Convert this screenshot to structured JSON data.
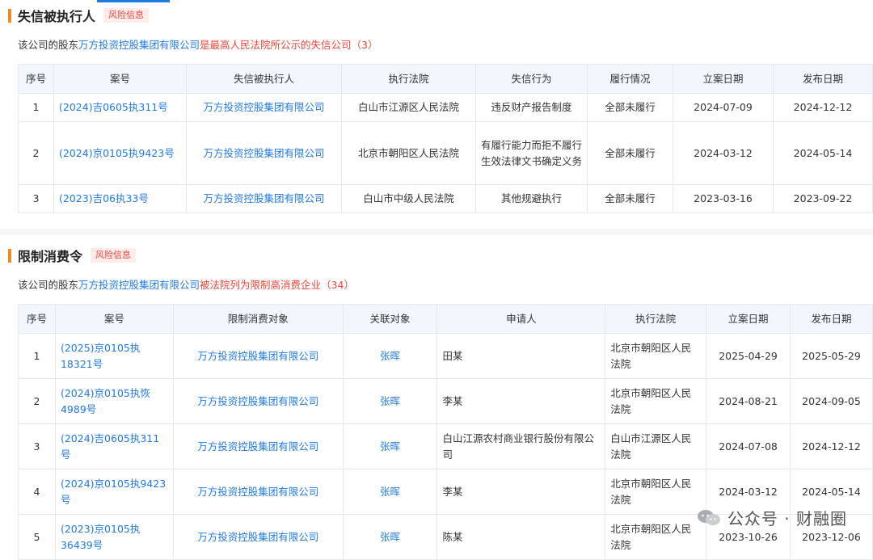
{
  "section1": {
    "title": "失信被执行人",
    "risk_tag": "风险信息",
    "summary_prefix": "该公司的股东",
    "summary_company": "万方投资控股集团有限公司",
    "summary_mid": "是最高人民法院所公示的失信公司",
    "summary_count": "（3）",
    "columns": [
      "序号",
      "案号",
      "失信被执行人",
      "执行法院",
      "失信行为",
      "履行情况",
      "立案日期",
      "发布日期"
    ],
    "rows": [
      {
        "no": "1",
        "case": "(2024)吉0605执311号",
        "party": "万方投资控股集团有限公司",
        "court": "白山市江源区人民法院",
        "behavior": "违反财产报告制度",
        "status": "全部未履行",
        "filed": "2024-07-09",
        "published": "2024-12-12"
      },
      {
        "no": "2",
        "case": "(2024)京0105执9423号",
        "party": "万方投资控股集团有限公司",
        "court": "北京市朝阳区人民法院",
        "behavior": "有履行能力而拒不履行生效法律文书确定义务",
        "status": "全部未履行",
        "filed": "2024-03-12",
        "published": "2024-05-14"
      },
      {
        "no": "3",
        "case": "(2023)吉06执33号",
        "party": "万方投资控股集团有限公司",
        "court": "白山市中级人民法院",
        "behavior": "其他规避执行",
        "status": "全部未履行",
        "filed": "2023-03-16",
        "published": "2023-09-22"
      }
    ]
  },
  "section2": {
    "title": "限制消费令",
    "risk_tag": "风险信息",
    "summary_prefix": "该公司的股东",
    "summary_company": "万方投资控股集团有限公司",
    "summary_mid": "被法院列为限制高消费企业",
    "summary_count": "（34）",
    "columns": [
      "序号",
      "案号",
      "限制消费对象",
      "关联对象",
      "申请人",
      "执行法院",
      "立案日期",
      "发布日期"
    ],
    "rows": [
      {
        "no": "1",
        "case": "(2025)京0105执18321号",
        "target": "万方投资控股集团有限公司",
        "related": "张晖",
        "applicant": "田某",
        "court": "北京市朝阳区人民法院",
        "filed": "2025-04-29",
        "published": "2025-05-29"
      },
      {
        "no": "2",
        "case": "(2024)京0105执恢4989号",
        "target": "万方投资控股集团有限公司",
        "related": "张晖",
        "applicant": "李某",
        "court": "北京市朝阳区人民法院",
        "filed": "2024-08-21",
        "published": "2024-09-05"
      },
      {
        "no": "3",
        "case": "(2024)吉0605执311号",
        "target": "万方投资控股集团有限公司",
        "related": "张晖",
        "applicant": "白山江源农村商业银行股份有限公司",
        "court": "白山市江源区人民法院",
        "filed": "2024-07-08",
        "published": "2024-12-12"
      },
      {
        "no": "4",
        "case": "(2024)京0105执9423号",
        "target": "万方投资控股集团有限公司",
        "related": "张晖",
        "applicant": "李某",
        "court": "北京市朝阳区人民法院",
        "filed": "2024-03-12",
        "published": "2024-05-14"
      },
      {
        "no": "5",
        "case": "(2023)京0105执36439号",
        "target": "万方投资控股集团有限公司",
        "related": "张晖",
        "applicant": "陈某",
        "court": "北京市朝阳区人民法院",
        "filed": "2023-10-26",
        "published": "2023-12-06"
      }
    ]
  },
  "watermark": {
    "text": "公众号 · 财融圈",
    "icon": "wechat-icon"
  }
}
